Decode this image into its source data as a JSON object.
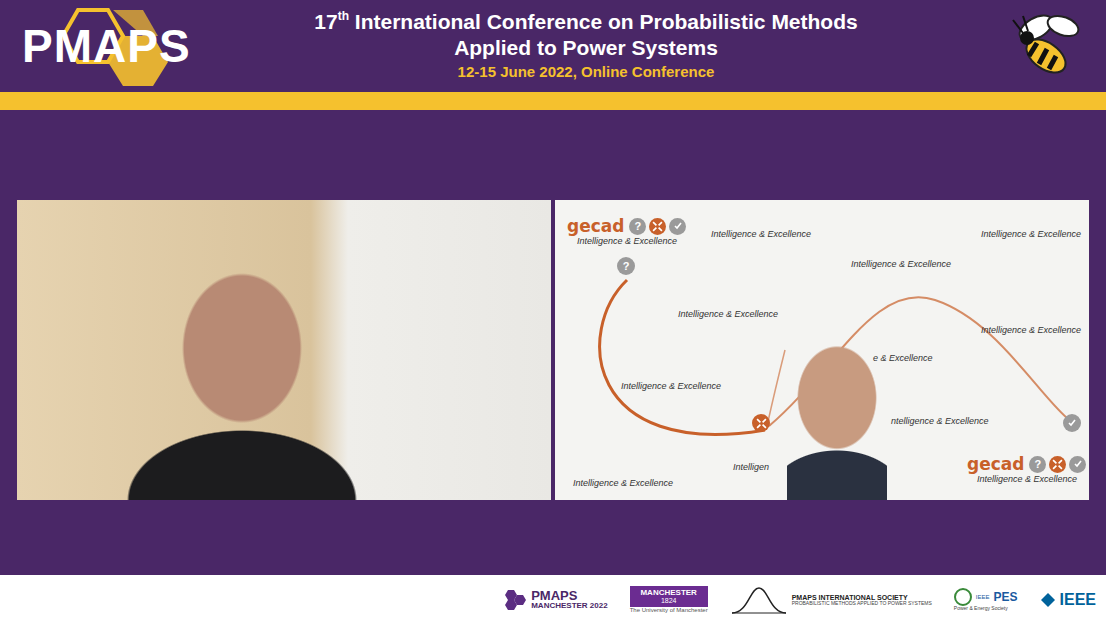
{
  "header": {
    "logo": "PMAPS",
    "title_number": "17",
    "title_suffix": "th",
    "title_line1": "International Conference on Probabilistic Methods",
    "title_line2": "Applied to Power Systems",
    "date": "12-15 June 2022, Online Conference"
  },
  "tiles": [
    {
      "kind": "camera",
      "name": "presenter-video"
    },
    {
      "kind": "screen-share",
      "name": "shared-slide"
    }
  ],
  "slide": {
    "brand": "gecad",
    "brand_icon": "?",
    "tagline": "Intelligence & Excellence",
    "labels": [
      "Intelligence & Excellence",
      "Intelligence & Excellence",
      "Intelligence & Excellence",
      "Intelligence & Excellence",
      "Intelligence & Excellence",
      "e & Excellence",
      "Intelligence & Excellence",
      "ntelligence & Excellence",
      "Intelligen",
      "Intelligence & Excellence"
    ]
  },
  "footer": {
    "pmaps": "PMAPS",
    "pmaps_sub": "MANCHESTER 2022",
    "uni": "MANCHESTER",
    "uni_year": "1824",
    "uni_sub": "The University of Manchester",
    "society": "PMAPS INTERNATIONAL SOCIETY",
    "society_sub": "PROBABILISTIC METHODS APPLIED TO POWER SYSTEMS",
    "pes": "PES",
    "pes_top": "IEEE",
    "pes_sub": "Power & Energy Society",
    "ieee": "IEEE"
  }
}
